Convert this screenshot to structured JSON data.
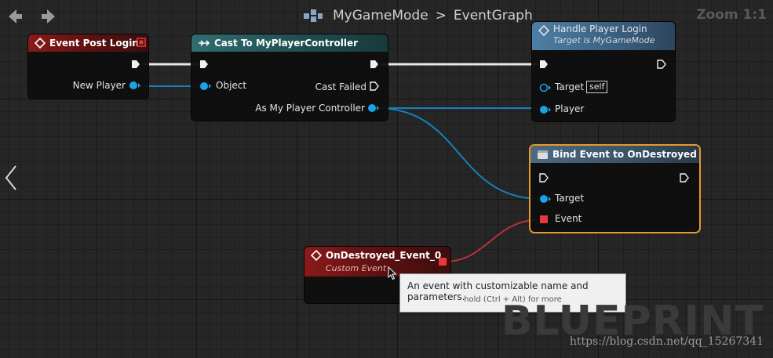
{
  "breadcrumb": {
    "graph": "MyGameMode",
    "subgraph": "EventGraph",
    "separator": ">"
  },
  "zoom_label": "Zoom 1:1",
  "nodes": {
    "event_post_login": {
      "title": "Event Post Login",
      "new_player": "New Player"
    },
    "cast": {
      "title": "Cast To MyPlayerController",
      "object": "Object",
      "cast_failed": "Cast Failed",
      "as_controller": "As My Player Controller"
    },
    "handle_login": {
      "title": "Handle Player Login",
      "subtitle": "Target is MyGameMode",
      "target": "Target",
      "self_badge": "self",
      "player": "Player"
    },
    "bind_event": {
      "title": "Bind Event to OnDestroyed",
      "target": "Target",
      "event": "Event"
    },
    "custom_event": {
      "title": "OnDestroyed_Event_0",
      "subtitle": "Custom Event"
    }
  },
  "tooltip": {
    "line1": "An event with customizable name and parameters.",
    "line2": "hold (Ctrl + Alt) for more"
  },
  "watermark": "BLUEPRINT",
  "url_watermark": "https://blog.csdn.net/qq_15267341",
  "colors": {
    "exec_wire": "#e8e8e8",
    "object_pin": "#1aa3e8",
    "object_wire": "#1680b8",
    "delegate_pin": "#e8383b",
    "delegate_wire": "#b83438",
    "selection": "#e59a2a"
  }
}
